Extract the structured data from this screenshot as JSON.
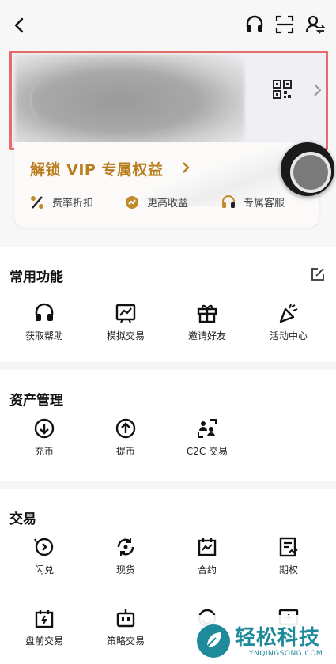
{
  "header": {
    "icons": [
      "back-icon",
      "headset-icon",
      "scan-icon",
      "switch-account-icon"
    ]
  },
  "vip": {
    "title": "解锁 VIP 专属权益",
    "perks": [
      {
        "label": "费率折扣",
        "icon": "percent-icon"
      },
      {
        "label": "更高收益",
        "icon": "yield-icon"
      },
      {
        "label": "专属客服",
        "icon": "headset-icon"
      }
    ],
    "accent": "#b97d1e"
  },
  "common": {
    "title": "常用功能",
    "items": [
      {
        "label": "获取帮助",
        "icon": "headset-icon"
      },
      {
        "label": "模拟交易",
        "icon": "demo-trade-icon"
      },
      {
        "label": "邀请好友",
        "icon": "gift-icon"
      },
      {
        "label": "活动中心",
        "icon": "party-icon"
      }
    ]
  },
  "assets": {
    "title": "资产管理",
    "items": [
      {
        "label": "充币",
        "icon": "deposit-icon"
      },
      {
        "label": "提币",
        "icon": "withdraw-icon"
      },
      {
        "label": "C2C 交易",
        "icon": "c2c-icon"
      }
    ]
  },
  "trade": {
    "title": "交易",
    "items": [
      {
        "label": "闪兑",
        "icon": "flash-swap-icon"
      },
      {
        "label": "现货",
        "icon": "spot-icon"
      },
      {
        "label": "合约",
        "icon": "futures-icon"
      },
      {
        "label": "期权",
        "icon": "options-icon"
      },
      {
        "label": "盘前交易",
        "icon": "pre-market-icon"
      },
      {
        "label": "策略交易",
        "icon": "bot-icon"
      },
      {
        "label": "",
        "icon": "smile-icon"
      },
      {
        "label": "",
        "icon": "demo-trade-icon"
      }
    ]
  },
  "watermark": {
    "title": "轻松科技",
    "subtitle": "YNQINGSONG.COM"
  }
}
